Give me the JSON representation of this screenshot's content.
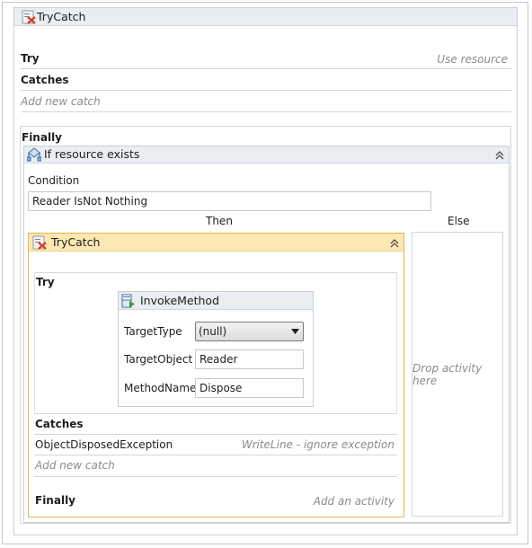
{
  "outer_try_catch": {
    "title": "TryCatch",
    "try_label": "Try",
    "try_action": "Use resource",
    "catches_label": "Catches",
    "add_new_catch": "Add new catch",
    "finally_label": "Finally"
  },
  "if_activity": {
    "title": "If resource exists",
    "condition_label": "Condition",
    "condition_value": "Reader IsNot Nothing",
    "then_label": "Then",
    "else_label": "Else",
    "drop_hint": "Drop activity here"
  },
  "inner_try_catch": {
    "title": "TryCatch",
    "try_label": "Try",
    "catches_label": "Catches",
    "catch_exception": "ObjectDisposedException",
    "catch_action": "WriteLine - ignore exception",
    "add_new_catch": "Add new catch",
    "finally_label": "Finally",
    "finally_action": "Add an activity"
  },
  "invoke_method": {
    "title": "InvokeMethod",
    "target_type_label": "TargetType",
    "target_type_value": "(null)",
    "target_object_label": "TargetObject",
    "target_object_value": "Reader",
    "method_name_label": "MethodName",
    "method_name_value": "Dispose"
  },
  "colors": {
    "header_blue": "#eaedf2",
    "selected_header": "#fce8b2",
    "selected_border": "#e8b54a",
    "hint_text": "#8b8b8b"
  },
  "icons": [
    "trycatch-icon",
    "if-icon",
    "invoke-method-icon",
    "collapse-icon",
    "dropdown-arrow-icon"
  ]
}
